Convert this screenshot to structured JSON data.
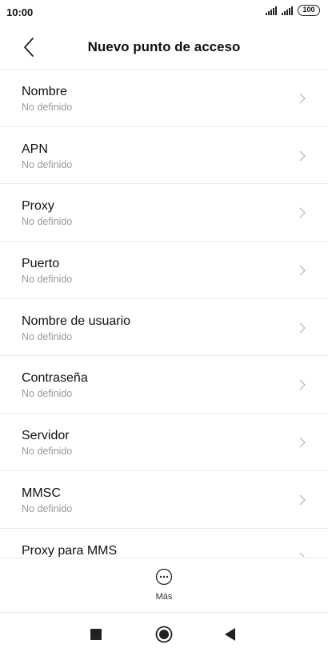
{
  "status": {
    "time": "10:00",
    "battery": "100",
    "icons": [
      "signal-icon",
      "signal-icon",
      "battery-icon"
    ]
  },
  "header": {
    "title": "Nuevo punto de acceso",
    "back_icon": "back-arrow-icon"
  },
  "items": [
    {
      "title": "Nombre",
      "subtitle": "No definido"
    },
    {
      "title": "APN",
      "subtitle": "No definido"
    },
    {
      "title": "Proxy",
      "subtitle": "No definido"
    },
    {
      "title": "Puerto",
      "subtitle": "No definido"
    },
    {
      "title": "Nombre de usuario",
      "subtitle": "No definido"
    },
    {
      "title": "Contraseña",
      "subtitle": "No definido"
    },
    {
      "title": "Servidor",
      "subtitle": "No definido"
    },
    {
      "title": "MMSC",
      "subtitle": "No definido"
    },
    {
      "title": "Proxy para MMS",
      "subtitle": ""
    }
  ],
  "bottom": {
    "more_label": "Más",
    "more_icon": "more-options-icon"
  },
  "nav": {
    "icons": [
      "recents-square-icon",
      "home-circle-icon",
      "back-triangle-icon"
    ]
  },
  "colors": {
    "divider": "#ececec",
    "subtitle": "#9a9a9a",
    "text": "#111111"
  }
}
